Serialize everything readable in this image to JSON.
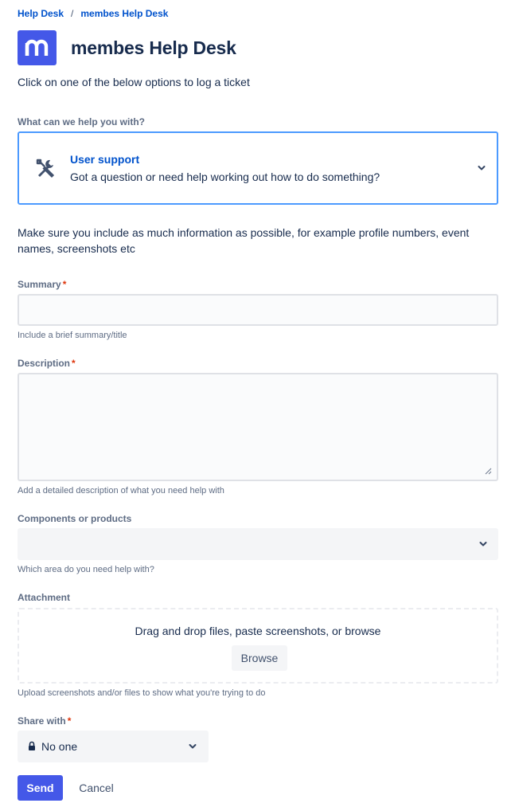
{
  "breadcrumb": {
    "root": "Help Desk",
    "separator": "/",
    "current": "membes Help Desk"
  },
  "header": {
    "logo_icon": "m-logo-icon",
    "title": "membes Help Desk"
  },
  "intro_text": "Click on one of the below options to log a ticket",
  "request_type": {
    "label": "What can we help you with?",
    "icon": "tools-icon",
    "title": "User support",
    "description": "Got a question or need help working out how to do something?"
  },
  "info_text": "Make sure you include as much information as possible, for example profile numbers, event names, screenshots etc",
  "summary": {
    "label": "Summary",
    "required": "*",
    "value": "",
    "helper": "Include a brief summary/title"
  },
  "description": {
    "label": "Description",
    "required": "*",
    "value": "",
    "helper": "Add a detailed description of what you need help with"
  },
  "components": {
    "label": "Components or products",
    "value": "",
    "helper": "Which area do you need help with?"
  },
  "attachment": {
    "label": "Attachment",
    "dropzone_text": "Drag and drop files, paste screenshots, or browse",
    "browse_label": "Browse",
    "helper": "Upload screenshots and/or files to show what you're trying to do"
  },
  "share_with": {
    "label": "Share with",
    "required": "*",
    "value": "No one"
  },
  "actions": {
    "send_label": "Send",
    "cancel_label": "Cancel"
  },
  "colors": {
    "brand": "#4458e8",
    "link": "#0052cc",
    "focus_border": "#4c9aff",
    "required": "#de350b"
  }
}
